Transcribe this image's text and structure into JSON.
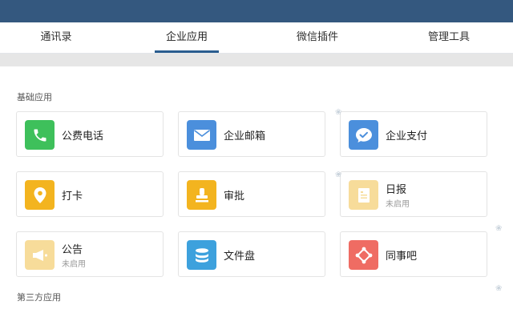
{
  "tabs": [
    {
      "label": "通讯录",
      "active": false
    },
    {
      "label": "企业应用",
      "active": true
    },
    {
      "label": "微信插件",
      "active": false
    },
    {
      "label": "管理工具",
      "active": false
    }
  ],
  "sections": {
    "basic": "基础应用",
    "third_party": "第三方应用"
  },
  "apps": [
    {
      "label": "公费电话",
      "icon": "phone-icon",
      "color": "#3ec05b"
    },
    {
      "label": "企业邮箱",
      "icon": "mail-icon",
      "color": "#4b8fdc"
    },
    {
      "label": "企业支付",
      "icon": "payment-icon",
      "color": "#4b8fdc"
    },
    {
      "label": "打卡",
      "icon": "location-pin-icon",
      "color": "#f3b41f"
    },
    {
      "label": "审批",
      "icon": "stamp-icon",
      "color": "#f3b41f"
    },
    {
      "label": "日报",
      "sub": "未启用",
      "icon": "report-icon",
      "color": "#f7dc9a"
    },
    {
      "label": "公告",
      "sub": "未启用",
      "icon": "megaphone-icon",
      "color": "#f7dc9a"
    },
    {
      "label": "文件盘",
      "icon": "disk-icon",
      "color": "#3da1dd"
    },
    {
      "label": "同事吧",
      "icon": "network-icon",
      "color": "#ef6c63"
    }
  ]
}
